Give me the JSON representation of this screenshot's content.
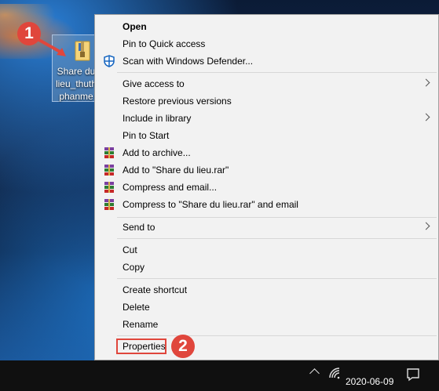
{
  "desktop": {
    "icon": {
      "name_lines": [
        "Share du",
        "lieu_thuth",
        "phanme"
      ],
      "icon": "folder-icon"
    },
    "markers": [
      "1",
      "2"
    ],
    "accent_color": "#e0463c"
  },
  "context_menu": {
    "items": [
      {
        "label": "Open",
        "bold": true
      },
      {
        "label": "Pin to Quick access"
      },
      {
        "label": "Scan with Windows Defender...",
        "icon": "shield-icon"
      },
      {
        "label": "Give access to",
        "submenu": true
      },
      {
        "label": "Restore previous versions"
      },
      {
        "label": "Include in library",
        "submenu": true
      },
      {
        "label": "Pin to Start"
      },
      {
        "label": "Add to archive...",
        "icon": "winrar-icon"
      },
      {
        "label": "Add to \"Share du lieu.rar\"",
        "icon": "winrar-icon"
      },
      {
        "label": "Compress and email...",
        "icon": "winrar-icon"
      },
      {
        "label": "Compress to \"Share du lieu.rar\" and email",
        "icon": "winrar-icon"
      },
      {
        "label": "Send to",
        "submenu": true
      },
      {
        "label": "Cut"
      },
      {
        "label": "Copy"
      },
      {
        "label": "Create shortcut"
      },
      {
        "label": "Delete"
      },
      {
        "label": "Rename"
      },
      {
        "label": "Properties",
        "highlighted": true
      }
    ]
  },
  "taskbar": {
    "date": "2020-06-09",
    "icons": [
      "chevron-up-icon",
      "wifi-icon",
      "notification-icon"
    ]
  }
}
